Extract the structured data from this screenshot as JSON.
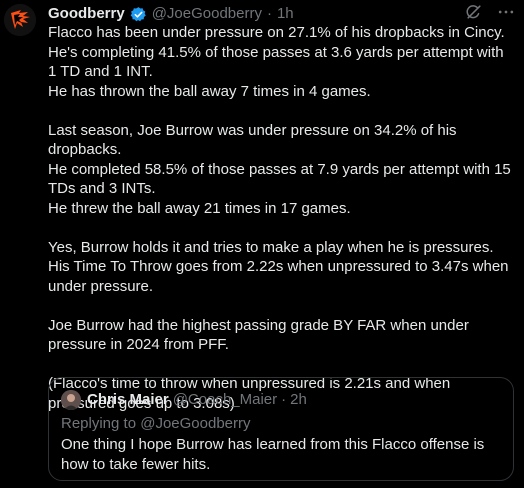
{
  "tweet": {
    "author_name": "Goodberry",
    "author_handle": "@JoeGoodberry",
    "separator": "·",
    "time": "1h",
    "paragraphs": [
      [
        "Flacco has been under pressure on 27.1% of his dropbacks in Cincy.",
        "He's completing 41.5% of those passes at 3.6 yards per attempt with 1 TD and 1 INT.",
        "He has thrown the ball away 7 times in 4 games."
      ],
      [
        "Last season, Joe Burrow was under pressure on 34.2% of his dropbacks.",
        "He completed 58.5% of those passes at 7.9 yards per attempt with 15 TDs and 3 INTs.",
        "He threw the ball away 21 times in 17 games."
      ],
      [
        "Yes, Burrow holds it and tries to make a play when he is pressures. His Time To Throw goes from 2.22s when unpressured to 3.47s when under pressure."
      ],
      [
        "Joe Burrow had the highest passing grade BY FAR when under pressure in 2024 from PFF."
      ],
      [
        "(Flacco's time to throw when unpressured is 2.21s and when pressured goes up to 3.08s)"
      ]
    ]
  },
  "quote": {
    "author_name": "Chris Maier",
    "author_handle": "@Coach_Maier",
    "separator": "·",
    "time": "2h",
    "replying_prefix": "Replying to ",
    "replying_to": "@JoeGoodberry",
    "text": "One thing I hope Burrow has learned from this Flacco offense is how to take fewer hits."
  },
  "colors": {
    "background": "#000000",
    "text": "#e7e9ea",
    "muted": "#71767b",
    "verified": "#1d9bf0",
    "border": "#2f3336"
  },
  "icons": [
    "bengals-logo-avatar",
    "verified-badge-icon",
    "grok-icon",
    "more-icon",
    "quoted-user-avatar"
  ]
}
